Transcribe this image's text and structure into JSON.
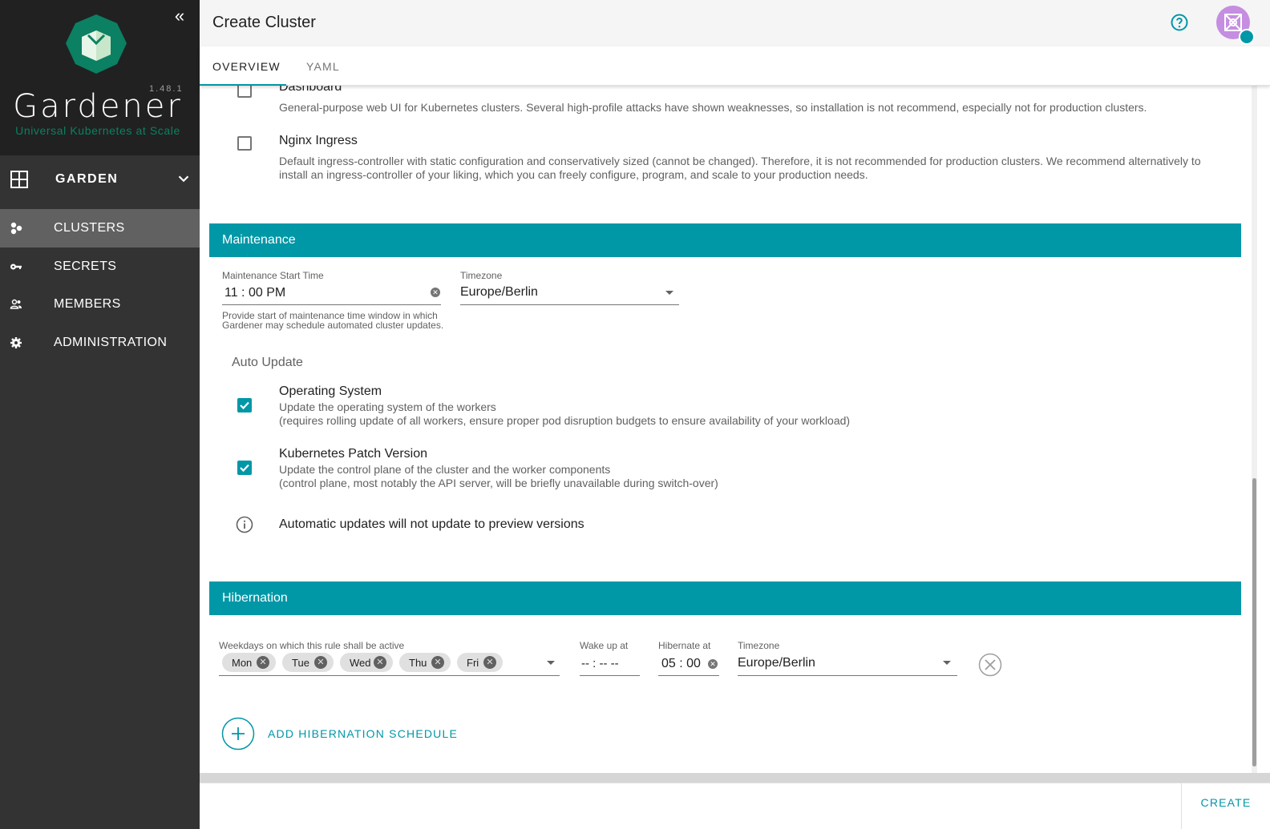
{
  "colors": {
    "accent": "#0097a7",
    "sidebar": "#333333",
    "brand_bg": "#212121",
    "tagline": "#0b8062"
  },
  "brand": {
    "name": "Gardener",
    "version": "1.48.1",
    "tagline": "Universal Kubernetes at Scale"
  },
  "sidebar": {
    "project": "GARDEN",
    "items": [
      {
        "label": "CLUSTERS",
        "icon": "clusters-icon",
        "active": true
      },
      {
        "label": "SECRETS",
        "icon": "key-icon",
        "active": false
      },
      {
        "label": "MEMBERS",
        "icon": "members-icon",
        "active": false
      },
      {
        "label": "ADMINISTRATION",
        "icon": "gear-icon",
        "active": false
      }
    ]
  },
  "header": {
    "title": "Create Cluster"
  },
  "tabs": [
    {
      "label": "OVERVIEW",
      "active": true
    },
    {
      "label": "YAML",
      "active": false
    }
  ],
  "addons": [
    {
      "title": "Dashboard",
      "checked": false,
      "desc": "General-purpose web UI for Kubernetes clusters. Several high-profile attacks have shown weaknesses, so installation is not recommend, especially not for production clusters."
    },
    {
      "title": "Nginx Ingress",
      "checked": false,
      "desc_line1": "Default ingress-controller with static configuration and conservatively sized (cannot be changed). Therefore, it is not recommended for production clusters. We recommend alternatively to",
      "desc_line2": "install an ingress-controller of your liking, which you can freely configure, program, and scale to your production needs."
    }
  ],
  "maintenance": {
    "header": "Maintenance",
    "start_time_label": "Maintenance Start Time",
    "start_time_value": "11 : 00  PM",
    "start_time_hint_line1": "Provide start of maintenance time window in which",
    "start_time_hint_line2": "Gardener may schedule automated cluster updates.",
    "timezone_label": "Timezone",
    "timezone_value": "Europe/Berlin",
    "auto_update_label": "Auto Update",
    "os": {
      "title": "Operating System",
      "checked": true,
      "desc_line1": "Update the operating system of the workers",
      "desc_line2": "(requires rolling update of all workers, ensure proper pod disruption budgets to ensure availability of your workload)"
    },
    "k8s": {
      "title": "Kubernetes Patch Version",
      "checked": true,
      "desc_line1": "Update the control plane of the cluster and the worker components",
      "desc_line2": "(control plane, most notably the API server, will be briefly unavailable during switch-over)"
    },
    "info": "Automatic updates will not update to preview versions"
  },
  "hibernation": {
    "header": "Hibernation",
    "weekdays_label": "Weekdays on which this rule shall be active",
    "weekdays": [
      "Mon",
      "Tue",
      "Wed",
      "Thu",
      "Fri"
    ],
    "wake_label": "Wake up at",
    "wake_value": "-- : --   --",
    "hibernate_label": "Hibernate at",
    "hibernate_value": "05 : 00",
    "timezone_label": "Timezone",
    "timezone_value": "Europe/Berlin",
    "add_label": "ADD HIBERNATION SCHEDULE"
  },
  "footer": {
    "create_label": "CREATE"
  }
}
